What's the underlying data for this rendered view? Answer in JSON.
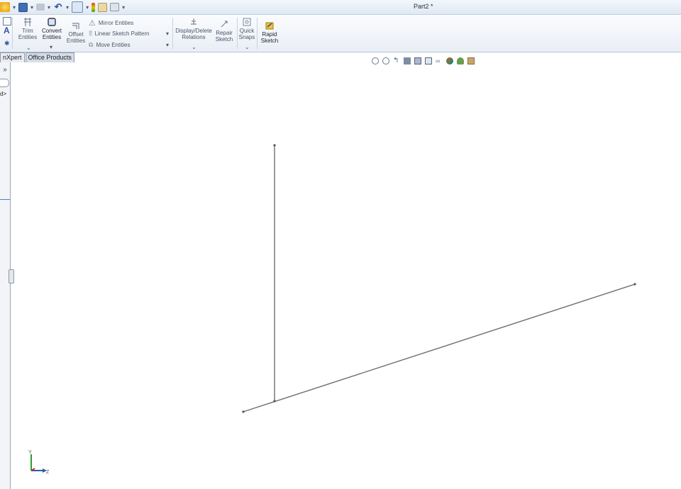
{
  "window": {
    "title": "Part2 *"
  },
  "ribbon": {
    "trim": "Trim\nEntities",
    "convert": "Convert\nEntities",
    "offset": "Offset\nEntities",
    "mirror": "Mirror Entities",
    "linear_pattern": "Linear Sketch Pattern",
    "move": "Move Entities",
    "display_delete": "Display/Delete\nRelations",
    "repair": "Repair\nSketch",
    "quick_snaps": "Quick\nSnaps",
    "rapid_sketch": "Rapid\nSketch"
  },
  "tabs": [
    "nXpert",
    "Office Products"
  ],
  "left_panel": {
    "expand": "»",
    "truncated_text": "d>"
  },
  "triad": {
    "y_label": "Y",
    "z_label": "Z"
  },
  "colors": {
    "ribbon_bg": "#eef2f7",
    "accent": "#3a6ea5",
    "sketch_line": "#707070"
  }
}
